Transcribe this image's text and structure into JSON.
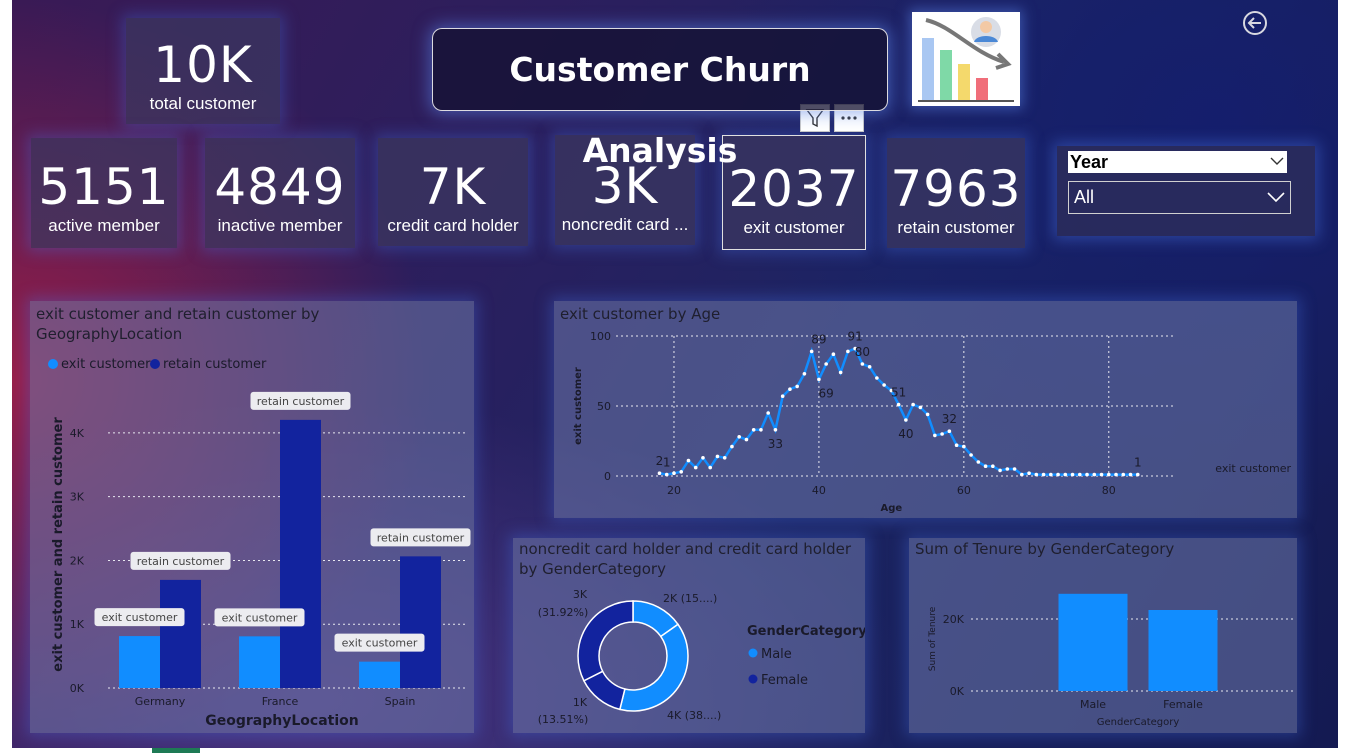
{
  "title": "Customer Churn Analysis",
  "kpis": {
    "total": {
      "value": "10K",
      "label": "total customer"
    },
    "active": {
      "value": "5151",
      "label": "active member"
    },
    "inactive": {
      "value": "4849",
      "label": "inactive member"
    },
    "credit": {
      "value": "7K",
      "label": "credit card holder"
    },
    "noncredit": {
      "value": "3K",
      "label": "noncredit card ..."
    },
    "exit": {
      "value": "2037",
      "label": "exit customer"
    },
    "retain": {
      "value": "7963",
      "label": "retain customer"
    }
  },
  "slicer": {
    "label": "Year",
    "value": "All"
  },
  "icons": {
    "back": "back-arrow-icon",
    "filter": "filter-icon",
    "more": "more-options-icon",
    "logo": "churn-chart-logo-icon",
    "dropdown": "chevron-down-icon"
  },
  "colors": {
    "exit": "#118dff",
    "retain": "#12239e",
    "female": "#12239e",
    "male": "#118dff",
    "line": "#118dff"
  },
  "geo_chart": {
    "title_line1": "exit customer and retain customer by",
    "title_line2": "GeographyLocation",
    "legend": [
      "exit customer",
      "retain customer"
    ],
    "ylabel": "exit customer and retain customer",
    "xlabel": "GeographyLocation",
    "yticks": [
      "0K",
      "1K",
      "2K",
      "3K",
      "4K"
    ],
    "tooltip_exit": "exit customer",
    "tooltip_retain": "retain customer"
  },
  "age_chart": {
    "title": "exit customer by Age",
    "ylabel": "exit customer",
    "xlabel": "Age",
    "series_label": "exit customer",
    "yticks": [
      "0",
      "50",
      "100"
    ],
    "xticks": [
      "20",
      "40",
      "60",
      "80"
    ]
  },
  "donut_chart": {
    "title_line1": "noncredit card holder and credit card holder",
    "title_line2": "by GenderCategory",
    "legend_title": "GenderCategory",
    "legend": [
      "Male",
      "Female"
    ],
    "labels": {
      "tl_a": "3K",
      "tl_b": "(31.92%)",
      "tr": "2K (15....)",
      "bl_a": "1K",
      "bl_b": "(13.51%)",
      "br": "4K (38....)"
    }
  },
  "tenure_chart": {
    "title": "Sum of Tenure by GenderCategory",
    "ylabel": "Sum of Tenure",
    "xlabel": "GenderCategory",
    "yticks": [
      "0K",
      "20K"
    ]
  },
  "chart_data": [
    {
      "type": "bar",
      "title": "exit customer and retain customer by GeographyLocation",
      "categories": [
        "Germany",
        "France",
        "Spain"
      ],
      "series": [
        {
          "name": "exit customer",
          "values": [
            814,
            810,
            413
          ]
        },
        {
          "name": "retain customer",
          "values": [
            1695,
            4204,
            2064
          ]
        }
      ],
      "xlabel": "GeographyLocation",
      "ylabel": "exit customer and retain customer",
      "ylim": [
        0,
        4500
      ],
      "legend": "top-left",
      "grid": true
    },
    {
      "type": "line",
      "title": "exit customer by Age",
      "xlabel": "Age",
      "ylabel": "exit customer",
      "xlim": [
        15,
        90
      ],
      "ylim": [
        0,
        100
      ],
      "x": [
        18,
        19,
        20,
        21,
        22,
        23,
        24,
        25,
        26,
        27,
        28,
        29,
        30,
        31,
        32,
        33,
        34,
        35,
        36,
        37,
        38,
        39,
        40,
        41,
        42,
        43,
        44,
        45,
        46,
        47,
        48,
        49,
        50,
        51,
        52,
        53,
        54,
        55,
        56,
        57,
        58,
        59,
        60,
        61,
        62,
        63,
        64,
        65,
        66,
        67,
        68,
        69,
        70,
        71,
        72,
        73,
        74,
        75,
        76,
        77,
        78,
        79,
        80,
        81,
        82,
        83,
        84
      ],
      "series": [
        {
          "name": "exit customer",
          "values": [
            2,
            1,
            2,
            3,
            11,
            6,
            13,
            6,
            14,
            13,
            21,
            28,
            26,
            33,
            33,
            45,
            33,
            57,
            62,
            64,
            73,
            89,
            69,
            80,
            87,
            74,
            89,
            91,
            80,
            78,
            70,
            65,
            61,
            51,
            40,
            51,
            49,
            44,
            29,
            30,
            32,
            22,
            21,
            15,
            10,
            7,
            7,
            4,
            5,
            5,
            1,
            2,
            1,
            1,
            1,
            1,
            1,
            1,
            1,
            1,
            1,
            1,
            1,
            1,
            1,
            1,
            1
          ]
        }
      ],
      "data_labels": [
        {
          "x": 18,
          "y": 2,
          "text": "2"
        },
        {
          "x": 19,
          "y": 1,
          "text": "1"
        },
        {
          "x": 34,
          "y": 33,
          "text": "33"
        },
        {
          "x": 40,
          "y": 89,
          "text": "89"
        },
        {
          "x": 41,
          "y": 69,
          "text": "69"
        },
        {
          "x": 45,
          "y": 91,
          "text": "91"
        },
        {
          "x": 46,
          "y": 80,
          "text": "80"
        },
        {
          "x": 51,
          "y": 51,
          "text": "51"
        },
        {
          "x": 52,
          "y": 40,
          "text": "40"
        },
        {
          "x": 58,
          "y": 32,
          "text": "32"
        },
        {
          "x": 84,
          "y": 1,
          "text": "1"
        }
      ],
      "grid": true
    },
    {
      "type": "pie",
      "title": "noncredit card holder and credit card holder by GenderCategory",
      "donut": true,
      "slices": [
        {
          "label": "2K",
          "percent": 15.0,
          "color": "#118dff"
        },
        {
          "label": "4K",
          "percent": 38.0,
          "color": "#118dff"
        },
        {
          "label": "1K",
          "percent": 13.51,
          "color": "#12239e"
        },
        {
          "label": "3K",
          "percent": 31.92,
          "color": "#12239e"
        }
      ],
      "legend": [
        "Male",
        "Female"
      ]
    },
    {
      "type": "bar",
      "title": "Sum of Tenure by GenderCategory",
      "categories": [
        "Male",
        "Female"
      ],
      "values": [
        27000,
        22500
      ],
      "xlabel": "GenderCategory",
      "ylabel": "Sum of Tenure",
      "ylim": [
        0,
        30000
      ]
    }
  ]
}
